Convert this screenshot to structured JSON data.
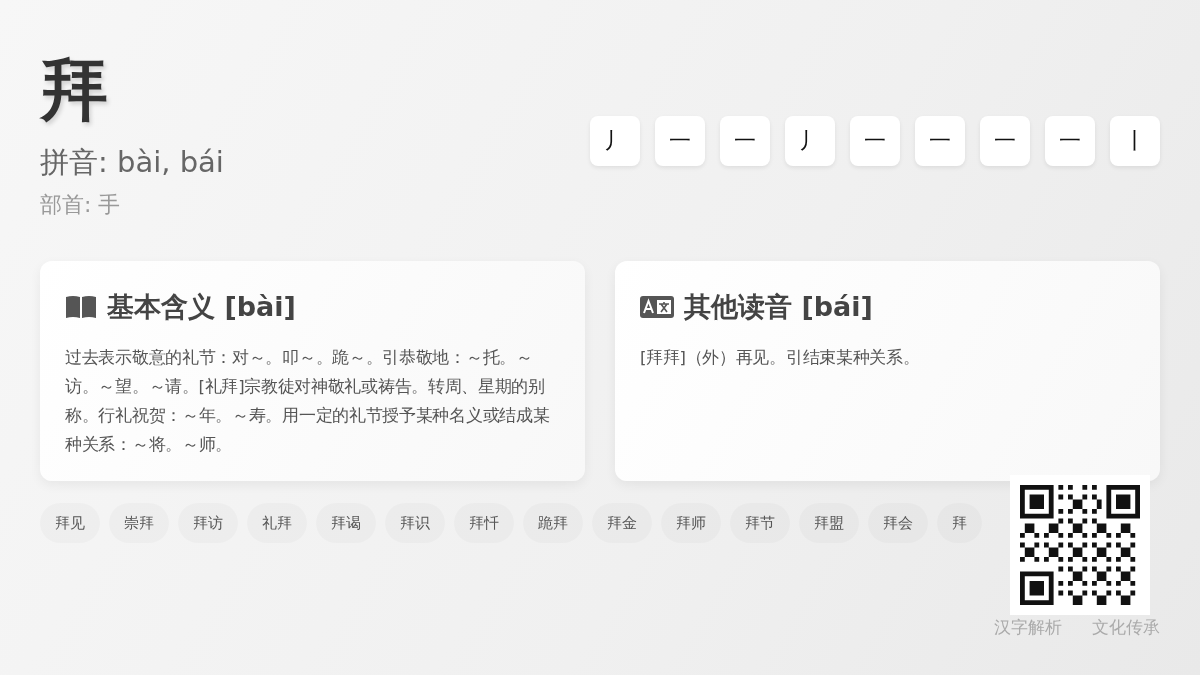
{
  "character": "拜",
  "pinyin": "拼音: bài, bái",
  "radical": "部首: 手",
  "strokes": [
    "丿",
    "一",
    "一",
    "丿",
    "一",
    "一",
    "一",
    "一",
    "丨"
  ],
  "cards": [
    {
      "kind": "book",
      "title": "基本含义 [bài]",
      "text": "过去表示敬意的礼节：对～。叩～。跪～。引恭敬地：～托。～访。～望。～请。[礼拜]宗教徒对神敬礼或祷告。转周、星期的别称。行礼祝贺：～年。～寿。用一定的礼节授予某种名义或结成某种关系：～将。～师。"
    },
    {
      "kind": "translate",
      "title": "其他读音 [bái]",
      "text": "[拜拜]（外）再见。引结束某种关系。"
    }
  ],
  "words": [
    "拜见",
    "崇拜",
    "拜访",
    "礼拜",
    "拜谒",
    "拜识",
    "拜忏",
    "跪拜",
    "拜金",
    "拜师",
    "拜节",
    "拜盟",
    "拜会",
    "拜"
  ],
  "qr": {
    "kind": "qr"
  },
  "footer": [
    "汉字解析",
    "文化传承"
  ]
}
